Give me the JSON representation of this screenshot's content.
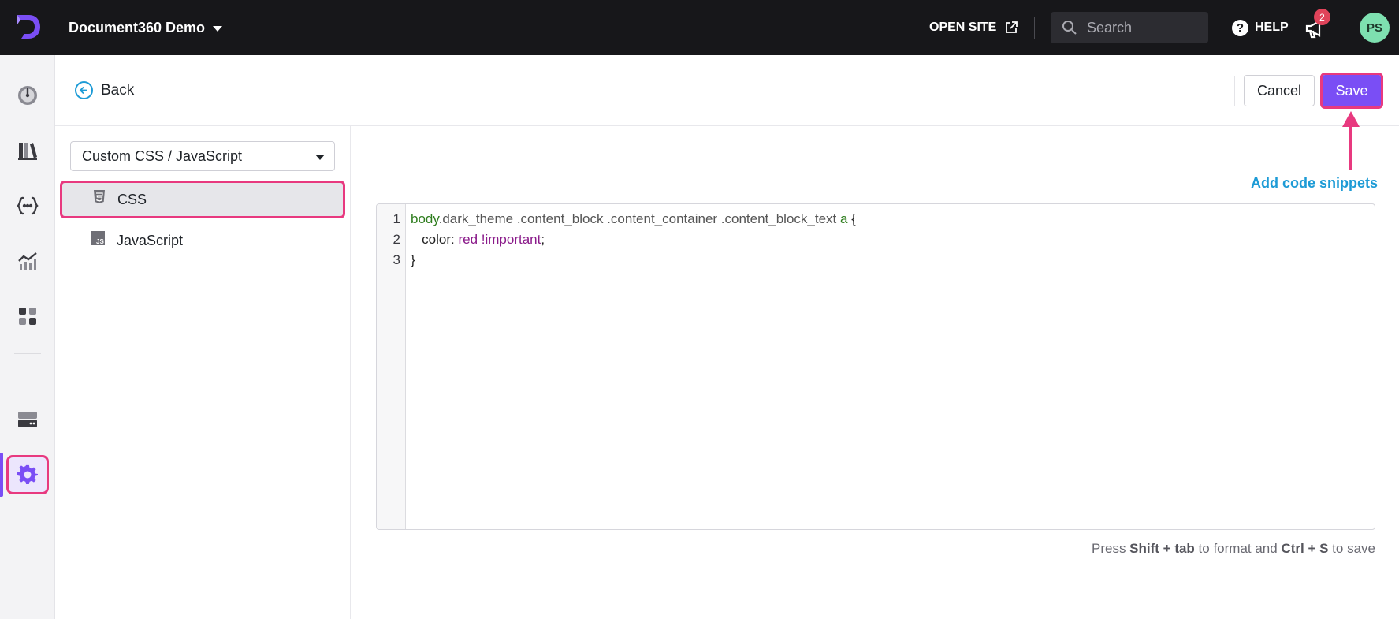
{
  "topbar": {
    "project_name": "Document360 Demo",
    "open_site_label": "OPEN SITE",
    "search_placeholder": "Search",
    "help_label": "HELP",
    "notification_count": "2",
    "avatar_initials": "PS"
  },
  "rail": {
    "items": [
      "dashboard-icon",
      "documentation-icon",
      "api-docs-icon",
      "analytics-icon",
      "widgets-icon",
      "drive-icon",
      "settings-icon"
    ],
    "active": "settings-icon"
  },
  "header": {
    "back_label": "Back",
    "cancel_label": "Cancel",
    "save_label": "Save"
  },
  "panel": {
    "select_value": "Custom CSS / JavaScript",
    "files": [
      {
        "label": "CSS",
        "icon": "css-file-icon",
        "active": true
      },
      {
        "label": "JavaScript",
        "icon": "js-file-icon",
        "active": false
      }
    ]
  },
  "editor": {
    "add_snippets_label": "Add code snippets",
    "line_numbers": [
      "1",
      "2",
      "3"
    ],
    "line1": {
      "tag": "body",
      "selectors": ".dark_theme .content_block .content_container .content_block_text ",
      "tag2": "a",
      "brace": " {"
    },
    "line2": {
      "prop": "   color: ",
      "value": "red !important",
      "end": ";"
    },
    "line3": "}",
    "hint": {
      "press": "Press ",
      "k1": "Shift + tab",
      "mid": " to format and ",
      "k2": "Ctrl + S",
      "end": " to save"
    }
  },
  "colors": {
    "topbar_bg": "#17171a",
    "accent": "#7a4ef5",
    "highlight": "#e8397f",
    "link": "#1d9bd6"
  }
}
